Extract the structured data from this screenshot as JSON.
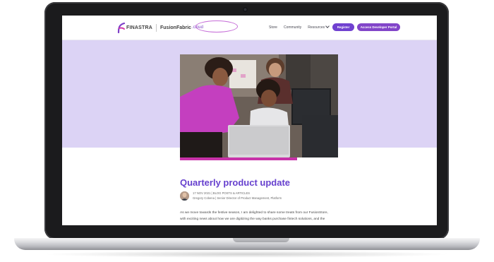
{
  "header": {
    "logo_finastra": "FINASTRA",
    "logo_fusion": "FusionFabric",
    "logo_cloud": ".cloud",
    "nav": [
      {
        "label": "Store"
      },
      {
        "label": "Community"
      },
      {
        "label": "Resources"
      }
    ],
    "register_label": "Register",
    "portal_label": "Access Developer Portal"
  },
  "article": {
    "title": "Quarterly product update",
    "date_category": "17 NOV 2021 | BLOG POSTS & ARTICLES",
    "author": "Gregory Cobena | Senior Director of Product Management, Platform",
    "body_line1": "As we move towards the festive season, I am delighted to share some treats from our FusionStore,",
    "body_line2": "with exciting news about how we are digitizing the way banks purchase fintech solutions, and the"
  },
  "colors": {
    "accent": "#6640ce",
    "button": "#7041d0",
    "hero_bg": "#dcd3f5",
    "magenta_bar": "#c832a9"
  }
}
